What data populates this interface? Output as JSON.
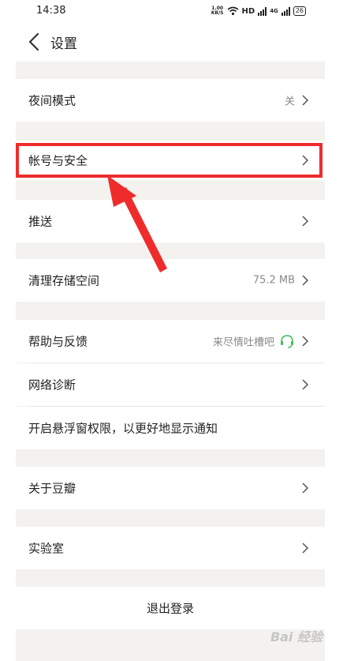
{
  "status_bar": {
    "time": "14:38",
    "net_speed_value": "1.00",
    "net_speed_unit": "KB/S",
    "hd_label": "HD",
    "network_label": "4G",
    "battery": "26"
  },
  "header": {
    "title": "设置"
  },
  "settings": {
    "night_mode": {
      "label": "夜间模式",
      "value": "关"
    },
    "account_security": {
      "label": "帐号与安全"
    },
    "push": {
      "label": "推送"
    },
    "storage": {
      "label": "清理存储空间",
      "value": "75.2 MB"
    },
    "feedback": {
      "label": "帮助与反馈",
      "value": "来尽情吐槽吧"
    },
    "network_diagnosis": {
      "label": "网络诊断"
    },
    "floating_window": {
      "label": "开启悬浮窗权限，以更好地显示通知"
    },
    "about": {
      "label": "关于豆瓣"
    },
    "lab": {
      "label": "实验室"
    },
    "logout": {
      "label": "退出登录"
    }
  },
  "annotation": {
    "highlight_color": "#ef2c2c"
  },
  "watermark": {
    "text": "Bai 经验"
  },
  "colors": {
    "background": "#f3f2ef",
    "row": "#ffffff",
    "secondary_text": "#888888",
    "headset_green": "#3bbd59"
  }
}
